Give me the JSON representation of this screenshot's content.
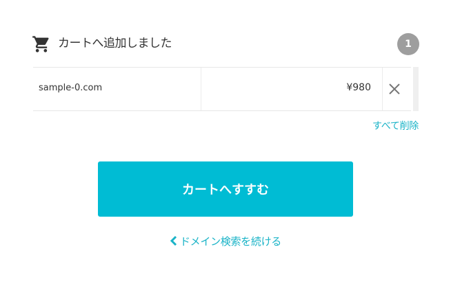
{
  "cart": {
    "title": "カートへ追加しました",
    "count": "1",
    "icon": "shopping-cart-icon"
  },
  "items": [
    {
      "domain": "sample-0.com",
      "price": "¥980"
    }
  ],
  "actions": {
    "remove_all": "すべて削除",
    "proceed": "カートへすすむ",
    "continue_search": "ドメイン検索を続ける"
  },
  "colors": {
    "accent": "#00bcd4",
    "link": "#19b3c7",
    "badge": "#9e9e9e",
    "text": "#333333"
  }
}
